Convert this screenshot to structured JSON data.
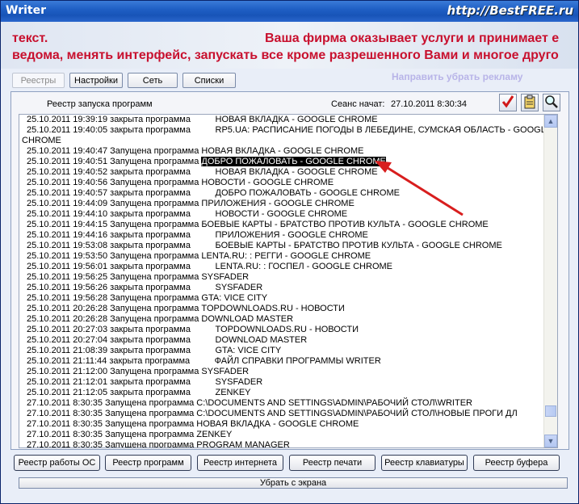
{
  "window": {
    "title": "Writer",
    "site": "http://BestFREE.ru"
  },
  "ticker": {
    "line1a": "текст.",
    "line1b": "Ваша фирма оказывает услуги и принимает e",
    "line2": "ведома, менять интерфейс, запускать все кроме разрешенного Вами и многое друго",
    "ghost": "Направить убрать рекламу"
  },
  "tabs": [
    "Реестры",
    "Настройки",
    "Сеть",
    "Списки"
  ],
  "panel": {
    "title": "Реестр запуска программ",
    "session_label": "Сеанс начат:",
    "session_value": "27.10.2011 8:30:34"
  },
  "log": [
    {
      "t": "25.10.2011 19:39:19 закрыта программа          НОВАЯ ВКЛАДКА - GOOGLE CHROME"
    },
    {
      "t": "25.10.2011 19:40:05 закрыта программа          RP5.UA: РАСПИСАНИЕ ПОГОДЫ В ЛЕБЕДИНЕ, СУМСКАЯ ОБЛАСТЬ - GOOGLE"
    },
    {
      "t": "CHROME",
      "cont": true
    },
    {
      "t": "25.10.2011 19:40:47 Запущена программа НОВАЯ ВКЛАДКА - GOOGLE CHROME"
    },
    {
      "t": "25.10.2011 19:40:51 Запущена программа ",
      "sel": "ДОБРО ПОЖАЛОВАТЬ - GOOGLE CHROME"
    },
    {
      "t": "25.10.2011 19:40:52 закрыта программа          НОВАЯ ВКЛАДКА - GOOGLE CHROME"
    },
    {
      "t": "25.10.2011 19:40:56 Запущена программа НОВОСТИ - GOOGLE CHROME"
    },
    {
      "t": "25.10.2011 19:40:57 закрыта программа          ДОБРО ПОЖАЛОВАТЬ - GOOGLE CHROME"
    },
    {
      "t": "25.10.2011 19:44:09 Запущена программа ПРИЛОЖЕНИЯ - GOOGLE CHROME"
    },
    {
      "t": "25.10.2011 19:44:10 закрыта программа          НОВОСТИ - GOOGLE CHROME"
    },
    {
      "t": "25.10.2011 19:44:15 Запущена программа БОЕВЫЕ КАРТЫ - БРАТСТВО ПРОТИВ КУЛЬТА - GOOGLE CHROME"
    },
    {
      "t": "25.10.2011 19:44:16 закрыта программа          ПРИЛОЖЕНИЯ - GOOGLE CHROME"
    },
    {
      "t": "25.10.2011 19:53:08 закрыта программа          БОЕВЫЕ КАРТЫ - БРАТСТВО ПРОТИВ КУЛЬТА - GOOGLE CHROME"
    },
    {
      "t": "25.10.2011 19:53:50 Запущена программа LENTA.RU: : РЕГГИ - GOOGLE CHROME"
    },
    {
      "t": "25.10.2011 19:56:01 закрыта программа          LENTA.RU: : ГОСПЕЛ - GOOGLE CHROME"
    },
    {
      "t": "25.10.2011 19:56:25 Запущена программа SYSFADER"
    },
    {
      "t": "25.10.2011 19:56:26 закрыта программа          SYSFADER"
    },
    {
      "t": "25.10.2011 19:56:28 Запущена программа GTA: VICE CITY"
    },
    {
      "t": "25.10.2011 20:26:28 Запущена программа TOPDOWNLOADS.RU - НОВОСТИ"
    },
    {
      "t": "25.10.2011 20:26:28 Запущена программа DOWNLOAD MASTER"
    },
    {
      "t": "25.10.2011 20:27:03 закрыта программа          TOPDOWNLOADS.RU - НОВОСТИ"
    },
    {
      "t": "25.10.2011 20:27:04 закрыта программа          DOWNLOAD MASTER"
    },
    {
      "t": "25.10.2011 21:08:39 закрыта программа          GTA: VICE CITY"
    },
    {
      "t": "25.10.2011 21:11:44 закрыта программа          ФАЙЛ СПРАВКИ ПРОГРАММЫ WRITER"
    },
    {
      "t": "25.10.2011 21:12:00 Запущена программа SYSFADER"
    },
    {
      "t": "25.10.2011 21:12:01 закрыта программа          SYSFADER"
    },
    {
      "t": "25.10.2011 21:12:05 закрыта программа          ZENKEY"
    },
    {
      "t": "27.10.2011 8:30:35 Запущена программа C:\\DOCUMENTS AND SETTINGS\\ADMIN\\РАБОЧИЙ СТОЛ\\WRITER"
    },
    {
      "t": "27.10.2011 8:30:35 Запущена программа C:\\DOCUMENTS AND SETTINGS\\ADMIN\\РАБОЧИЙ СТОЛ\\НОВЫЕ ПРОГИ ДЛ"
    },
    {
      "t": "27.10.2011 8:30:35 Запущена программа НОВАЯ ВКЛАДКА - GOOGLE CHROME"
    },
    {
      "t": "27.10.2011 8:30:35 Запущена программа ZENKEY"
    },
    {
      "t": "27.10.2011 8:30:35 Запущена программа PROGRAM MANAGER"
    }
  ],
  "buttons": [
    "Реестр работы ОС",
    "Реестр программ",
    "Реестр интернета",
    "Реестр печати",
    "Реестр клавиатуры",
    "Реестр буфера"
  ],
  "close_label": "Убрать с экрана",
  "colors": {
    "title_bar": "#1f5fc4",
    "ticker_text": "#c8102e",
    "arrow": "#d81e1e"
  }
}
